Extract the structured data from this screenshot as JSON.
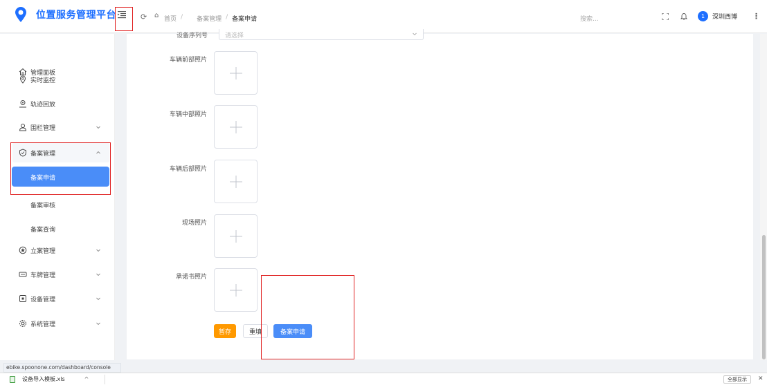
{
  "app": {
    "title": "位置服务管理平台",
    "brand_color": "#1e6fff"
  },
  "header": {
    "breadcrumbs": [
      "首页",
      "备案管理",
      "备案申请"
    ],
    "search_placeholder": "搜索...",
    "user_name": "深圳西博",
    "avatar_glyph": "1"
  },
  "sidebar": {
    "items": [
      {
        "label": "管理面板",
        "icon": "home-icon"
      },
      {
        "label": "实时监控",
        "icon": "location-icon"
      },
      {
        "label": "轨迹回放",
        "icon": "track-icon"
      },
      {
        "label": "围栏管理",
        "icon": "fence-icon",
        "expandable": true
      },
      {
        "label": "备案管理",
        "icon": "shield-icon",
        "expanded": true
      },
      {
        "label": "立案管理",
        "icon": "case-icon",
        "expandable": true
      },
      {
        "label": "车牌管理",
        "icon": "plate-icon",
        "expandable": true
      },
      {
        "label": "设备管理",
        "icon": "device-icon",
        "expandable": true
      },
      {
        "label": "系统管理",
        "icon": "settings-icon",
        "expandable": true
      }
    ],
    "subitems": [
      {
        "label": "备案申请",
        "active": true
      },
      {
        "label": "备案审核"
      },
      {
        "label": "备案查询"
      }
    ]
  },
  "form": {
    "partial_label": "设备序列号",
    "select_placeholder": "请选择",
    "upload_fields": [
      {
        "label": "车辆前部照片"
      },
      {
        "label": "车辆中部照片"
      },
      {
        "label": "车辆后部照片"
      },
      {
        "label": "现场照片"
      },
      {
        "label": "承诺书照片"
      }
    ],
    "buttons": {
      "save": "暂存",
      "reset": "重填",
      "submit": "备案申请"
    }
  },
  "status_url": "ebike.spoonone.com/dashboard/console",
  "download_bar": {
    "file_name": "设备导入模板.xls",
    "show_all": "全部显示"
  },
  "colors": {
    "primary": "#4a8df8",
    "warning": "#ff9900",
    "annotation": "#e02020"
  }
}
